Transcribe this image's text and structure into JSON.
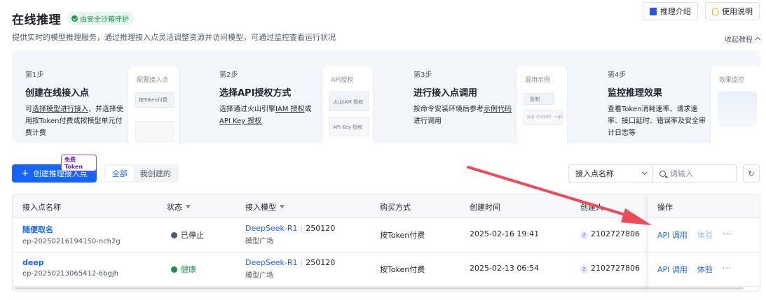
{
  "header": {
    "title": "在线推理",
    "badge": "由安全沙箱守护",
    "subtitle": "提供实时的模型推理服务，通过推理接入点灵活调整资源并访问模型，可通过监控查看运行状况"
  },
  "top_buttons": {
    "intro": "推理介绍",
    "guide": "使用说明"
  },
  "collapse_label": "收起教程",
  "steps": [
    {
      "num": "第1步",
      "title": "创建在线接入点",
      "desc_pre": "可",
      "desc_link": "选择模型进行接入",
      "desc_post": "，并选择使用按Token付费或按模型单元付费计费",
      "preview_title": "配置接入点",
      "preview_box": "按Token付费"
    },
    {
      "num": "第2步",
      "title": "选择API授权方式",
      "desc_pre": "选择通过火山引擎",
      "desc_link": "IAM 授权",
      "desc_mid": "或",
      "desc_link2": "API Key 授权",
      "preview_title": "API授权",
      "preview_box": "火山IAM 授权",
      "preview_box2": "API Key 授权"
    },
    {
      "num": "第3步",
      "title": "进行接入点调用",
      "desc_pre": "按命令安装环境后参考",
      "desc_link": "示例代码",
      "desc_post": "进行调用",
      "preview_title": "调用示例",
      "preview_box": "复制",
      "preview_box2": "pip install --up"
    },
    {
      "num": "第4步",
      "title": "监控推理效果",
      "desc_post": "查看Token消耗速率、请求速率、接口延时、错误率及安全审计日志等",
      "preview_title": "效果监控"
    }
  ],
  "toolbar": {
    "create_label": "创建推理接入点",
    "free_token": "免费Token",
    "tab_all": "全部",
    "tab_mine": "我创建的"
  },
  "filter": {
    "select_label": "接入点名称",
    "search_placeholder": "请输入"
  },
  "table": {
    "columns": [
      "接入点名称",
      "状态",
      "接入模型",
      "购买方式",
      "创建时间",
      "创建人",
      "操作"
    ],
    "rows": [
      {
        "name": "随便取名",
        "id": "ep-20250216194150-nch2g",
        "status": "已停止",
        "status_color": "#86909c",
        "model": "DeepSeek-R1",
        "version": "250120",
        "source": "模型广场",
        "billing": "按Token付费",
        "created": "2025-02-16 19:41",
        "creator_badge": "2",
        "creator": "2102727806",
        "op_api": "API 调用",
        "op_try": "体验",
        "op_more": "···"
      },
      {
        "name": "deep",
        "id": "ep-20250213065412-6bgjh",
        "status": "健康",
        "status_color": "#1f8f4a",
        "model": "DeepSeek-R1",
        "version": "250120",
        "source": "模型广场",
        "billing": "按Token付费",
        "created": "2025-02-13 06:54",
        "creator_badge": "2",
        "creator": "2102727806",
        "op_api": "API 调用",
        "op_try": "体验",
        "op_more": "···"
      }
    ]
  },
  "colors": {
    "primary": "#1664ff",
    "arrow": "#ee4a5a"
  }
}
